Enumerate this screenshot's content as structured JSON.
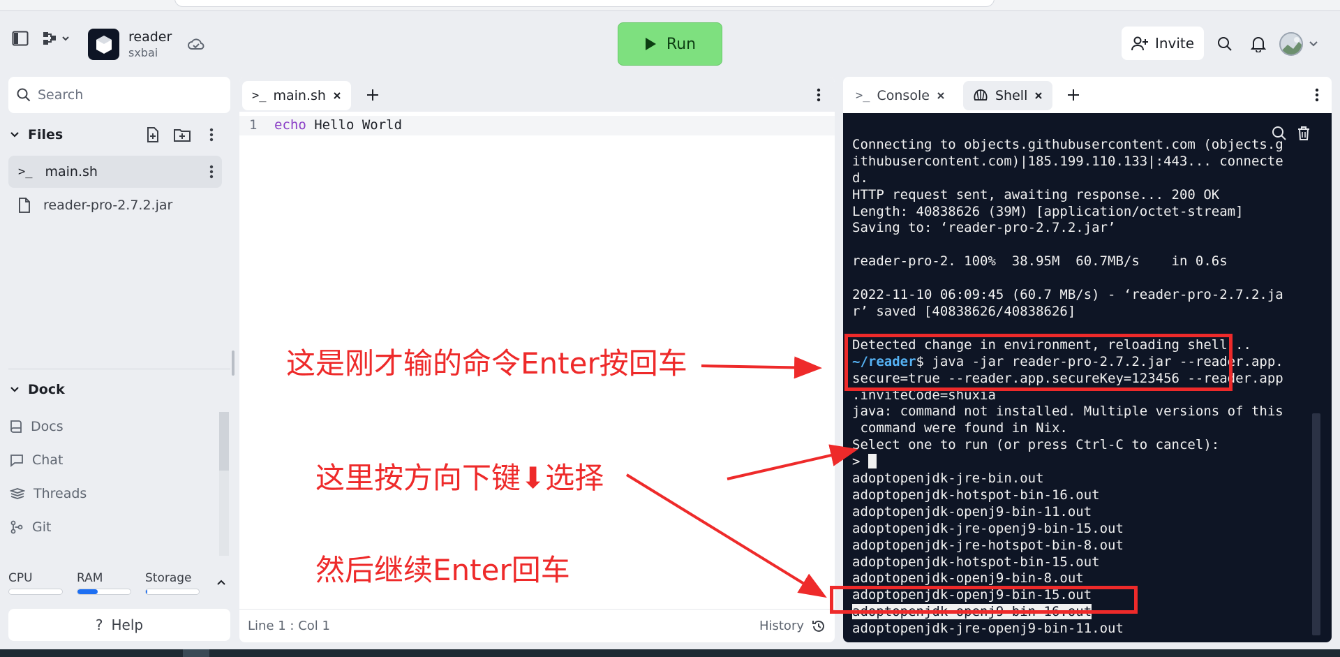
{
  "header": {
    "repl_name": "reader",
    "repl_owner": "sxbai",
    "run_label": "Run",
    "invite_label": "Invite"
  },
  "sidebar": {
    "search_placeholder": "Search",
    "files_heading": "Files",
    "files": [
      {
        "name": "main.sh",
        "icon": "terminal-icon",
        "active": true
      },
      {
        "name": "reader-pro-2.7.2.jar",
        "icon": "file-icon",
        "active": false
      }
    ],
    "dock_heading": "Dock",
    "dock_items": [
      {
        "label": "Docs",
        "icon": "book-icon"
      },
      {
        "label": "Chat",
        "icon": "chat-icon"
      },
      {
        "label": "Threads",
        "icon": "threads-icon"
      },
      {
        "label": "Git",
        "icon": "git-icon"
      }
    ],
    "resources": [
      {
        "label": "CPU",
        "level": 0.0
      },
      {
        "label": "RAM",
        "level": 0.38
      },
      {
        "label": "Storage",
        "level": 0.03
      }
    ],
    "help_label": "Help"
  },
  "editor": {
    "tab_label": "main.sh",
    "line_number": "1",
    "code_keyword": "echo",
    "code_rest": " Hello World",
    "status_position": "Line 1 : Col 1",
    "history_label": "History"
  },
  "right_pane": {
    "tabs": [
      {
        "label": "Console",
        "active": false
      },
      {
        "label": "Shell",
        "active": true
      }
    ]
  },
  "terminal": {
    "lines": [
      "Connecting to objects.githubusercontent.com (objects.g",
      "ithubusercontent.com)|185.199.110.133|:443... connecte",
      "d.",
      "HTTP request sent, awaiting response... 200 OK",
      "Length: 40838626 (39M) [application/octet-stream]",
      "Saving to: ‘reader-pro-2.7.2.jar’",
      "",
      "reader-pro-2. 100%  38.95M  60.7MB/s    in 0.6s",
      "",
      "2022-11-10 06:09:45 (60.7 MB/s) - ‘reader-pro-2.7.2.ja",
      "r’ saved [40838626/40838626]",
      "",
      "Detected change in environment, reloading shell..."
    ],
    "prompt_dir": "~/reader",
    "command_first": "$ java -jar reader-pro-2.7.2.jar --reader.app.",
    "command_lines": [
      "secure=true --reader.app.secureKey=123456 --reader.app",
      ".inviteCode=shuxia"
    ],
    "after_lines": [
      "java: command not installed. Multiple versions of this",
      " command were found in Nix.",
      "Select one to run (or press Ctrl-C to cancel):"
    ],
    "select_prompt": "> ",
    "options": [
      "adoptopenjdk-jre-bin.out",
      "adoptopenjdk-hotspot-bin-16.out",
      "adoptopenjdk-openj9-bin-11.out",
      "adoptopenjdk-jre-openj9-bin-15.out",
      "adoptopenjdk-jre-hotspot-bin-8.out",
      "adoptopenjdk-hotspot-bin-15.out",
      "adoptopenjdk-openj9-bin-8.out",
      "adoptopenjdk-openj9-bin-15.out"
    ],
    "highlighted_option": "adoptopenjdk-openj9-bin-16.out",
    "last_option": "adoptopenjdk-jre-openj9-bin-11.out"
  },
  "annotations": {
    "note_1": "这是刚才输的命令Enter按回车",
    "note_2": "这里按方向下键⬇选择",
    "note_3": "然后继续Enter回车",
    "color": "#ee2a2a"
  },
  "colors": {
    "run_button": "#7ee07f",
    "terminal_bg": "#0e1525",
    "prompt_dir": "#56b3f5",
    "keyword": "#8a3ec6",
    "accent": "#1d6ff2"
  }
}
